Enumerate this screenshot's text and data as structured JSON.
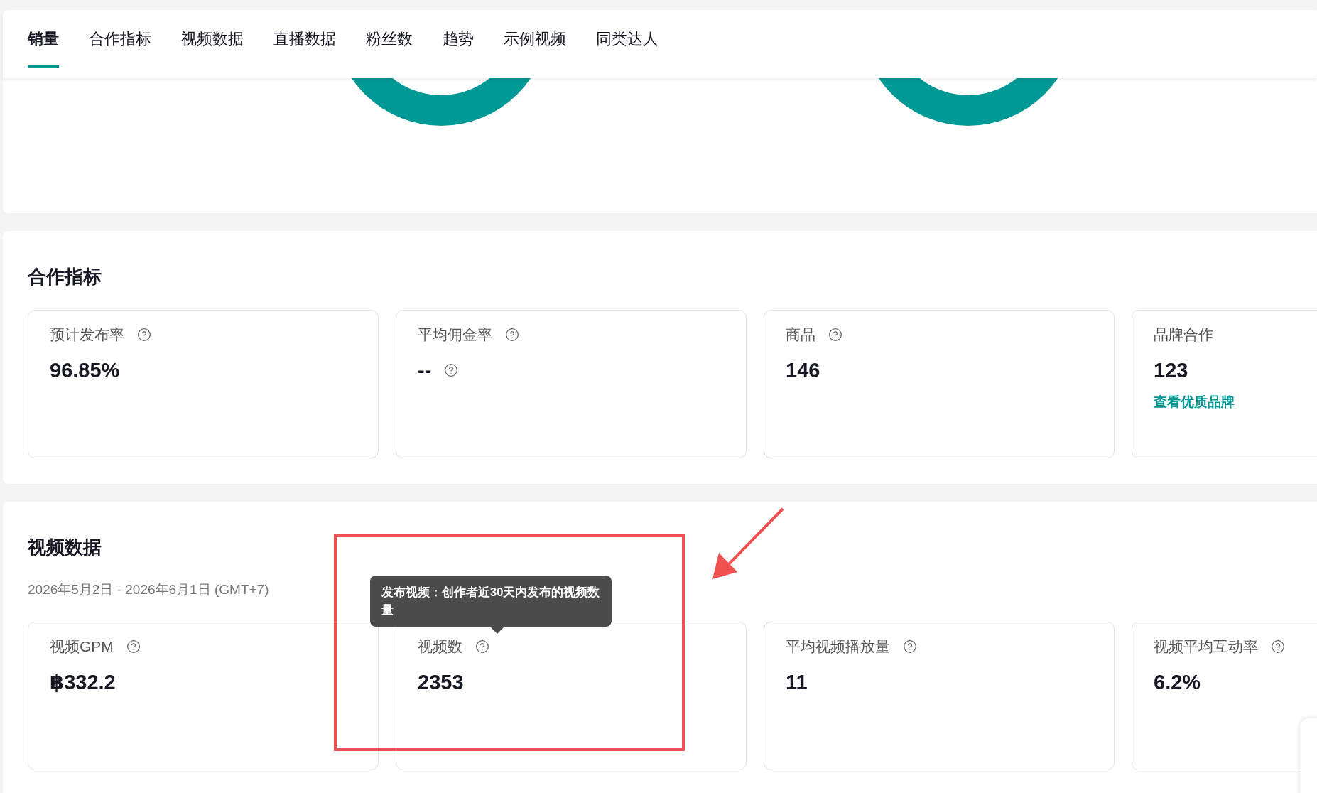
{
  "tabs": [
    {
      "label": "销量",
      "selected": true
    },
    {
      "label": "合作指标",
      "selected": false
    },
    {
      "label": "视频数据",
      "selected": false
    },
    {
      "label": "直播数据",
      "selected": false
    },
    {
      "label": "粉丝数",
      "selected": false
    },
    {
      "label": "趋势",
      "selected": false
    },
    {
      "label": "示例视频",
      "selected": false
    },
    {
      "label": "同类达人",
      "selected": false
    }
  ],
  "cooperation": {
    "title": "合作指标",
    "metrics": [
      {
        "label": "预计发布率",
        "help": true,
        "value": "96.85%",
        "value_help": false
      },
      {
        "label": "平均佣金率",
        "help": true,
        "value": "--",
        "value_help": true
      },
      {
        "label": "商品",
        "help": true,
        "value": "146",
        "value_help": false
      },
      {
        "label": "品牌合作",
        "help": false,
        "value": "123",
        "value_help": false,
        "link": "查看优质品牌"
      }
    ]
  },
  "video": {
    "title": "视频数据",
    "date_range": "2026年5月2日 - 2026年6月1日 (GMT+7)",
    "metrics": [
      {
        "label": "视频GPM",
        "help": true,
        "value": "฿332.2",
        "value_help": false
      },
      {
        "label": "视频数",
        "help": true,
        "value": "2353",
        "value_help": false
      },
      {
        "label": "平均视频播放量",
        "help": true,
        "value": "11",
        "value_help": false
      },
      {
        "label": "视频平均互动率",
        "help": true,
        "value": "6.2%",
        "value_help": false
      }
    ],
    "tooltip": {
      "text": "发布视频：创作者近30天内发布的视频数量"
    }
  }
}
